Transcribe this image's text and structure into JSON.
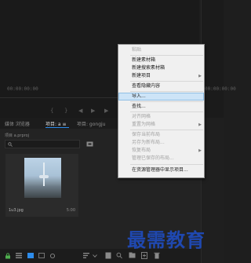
{
  "program_monitor": {
    "timecode": "00:00:00:00"
  },
  "source_monitor": {
    "timecode": "00:00:00:00"
  },
  "project_panel": {
    "tabs": [
      {
        "label": "媒体 浏览器"
      },
      {
        "label": "项目: a ≡"
      },
      {
        "label": "项目: gongju"
      }
    ],
    "project_name": "项目 a.prproj",
    "clip": {
      "name": "1u3.jpg",
      "duration": "5:00"
    }
  },
  "context_menu": {
    "items": [
      {
        "label": "粘贴",
        "disabled": true
      },
      {
        "label": "新建素材箱"
      },
      {
        "label": "新建搜索素材箱"
      },
      {
        "label": "新建项目",
        "submenu": true
      },
      {
        "label": "查看隐藏内容"
      },
      {
        "label": "导入...",
        "highlighted": true
      },
      {
        "label": "查找..."
      },
      {
        "label": "对齐网格",
        "disabled": true
      },
      {
        "label": "重置为网格",
        "disabled": true,
        "submenu": true
      },
      {
        "label": "保存当前布局",
        "disabled": true
      },
      {
        "label": "另存为新布局...",
        "disabled": true
      },
      {
        "label": "恢复布局",
        "disabled": true,
        "submenu": true
      },
      {
        "label": "管理已保存的布局...",
        "disabled": true
      },
      {
        "label": "在资源管理器中显示项目..."
      }
    ]
  },
  "watermark": {
    "text": "最需教育"
  },
  "colors": {
    "accent": "#2d8ceb",
    "watermark": "#1f48b0",
    "menu_highlight": "#cde4f7"
  }
}
